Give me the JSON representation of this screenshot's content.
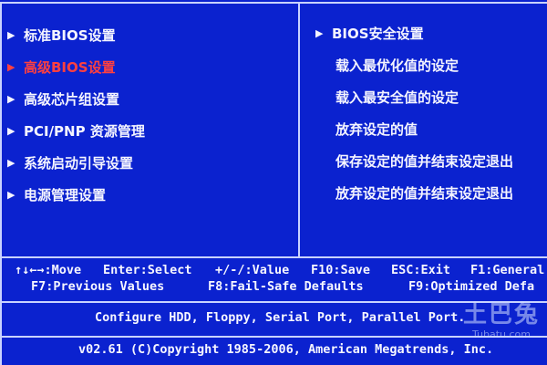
{
  "left_menu": {
    "items": [
      {
        "label": "标准BIOS设置",
        "selected": false
      },
      {
        "label": "高级BIOS设置",
        "selected": true
      },
      {
        "label": "高级芯片组设置",
        "selected": false
      },
      {
        "label": "PCI/PNP 资源管理",
        "selected": false
      },
      {
        "label": "系统启动引导设置",
        "selected": false
      },
      {
        "label": "电源管理设置",
        "selected": false
      }
    ]
  },
  "right_menu": {
    "items": [
      {
        "label": "BIOS安全设置",
        "has_arrow": true
      },
      {
        "label": "载入最优化值的设定",
        "has_arrow": false
      },
      {
        "label": "载入最安全值的设定",
        "has_arrow": false
      },
      {
        "label": "放弃设定的值",
        "has_arrow": false
      },
      {
        "label": "保存设定的值并结束设定退出",
        "has_arrow": false
      },
      {
        "label": "放弃设定的值并结束设定退出",
        "has_arrow": false
      }
    ]
  },
  "keys": {
    "row1": [
      "↑↓←→:Move",
      "Enter:Select",
      "+/-/:Value",
      "F10:Save",
      "ESC:Exit",
      "F1:General"
    ],
    "row2": [
      "F7:Previous Values",
      "F8:Fail-Safe Defaults",
      "F9:Optimized Defa"
    ]
  },
  "help_text": "Configure HDD, Floppy, Serial Port, Parallel Port.",
  "copyright": "v02.61 (C)Copyright 1985-2006, American Megatrends, Inc.",
  "watermark": {
    "big": "土巴兔",
    "small": "Tubatu.com"
  },
  "icons": {
    "arrow": "▶"
  },
  "colors": {
    "background": "#0b22cf",
    "selected": "#ff4040",
    "text": "#f4f4ff"
  }
}
